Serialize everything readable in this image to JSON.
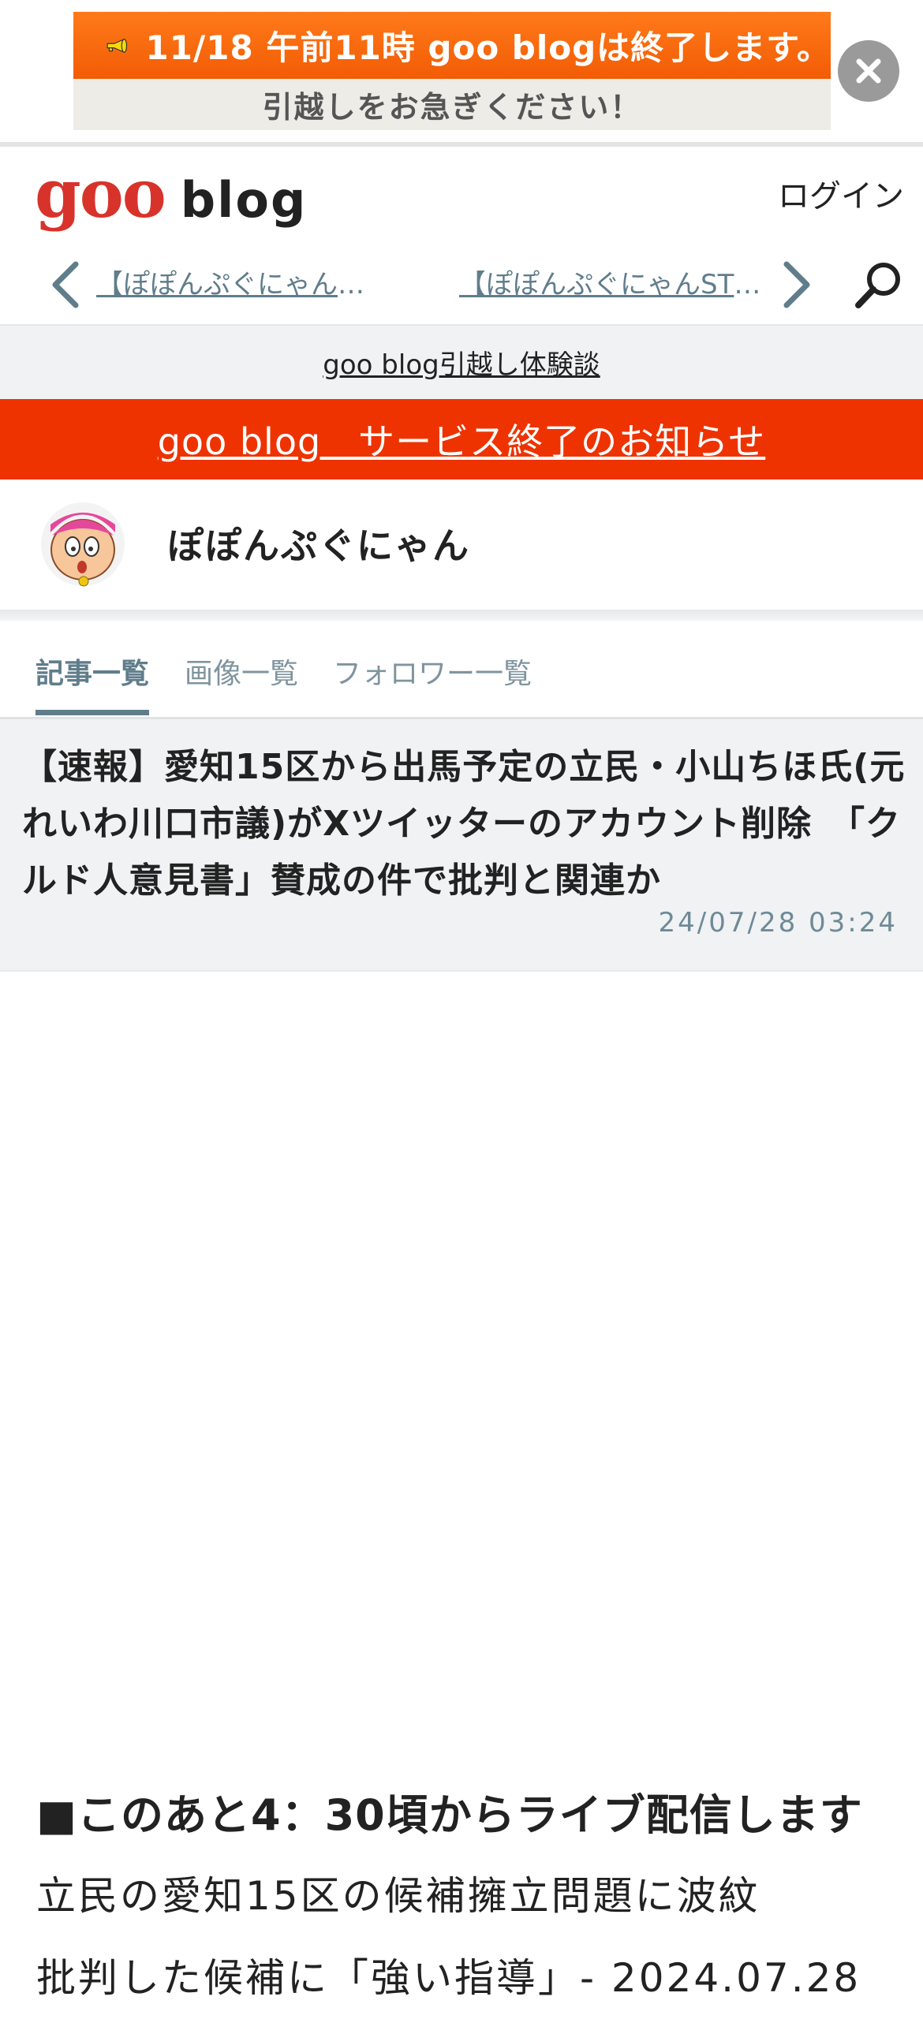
{
  "banner": {
    "line1": "11/18 午前11時 goo blogは終了します。",
    "line2": "引越しをお急ぎください！",
    "close_icon": "close-icon"
  },
  "header": {
    "logo_goo": "goo",
    "logo_blog": "blog",
    "login": "ログイン"
  },
  "nav": {
    "prev": "【ぽぽんぷぐにゃんライブ】",
    "next": "【ぽぽんぷぐにゃんSTUDIO】",
    "search_icon": "search-icon"
  },
  "experience_link": "goo blog引越し体験談",
  "notice_link": "goo blog　サービス終了のお知らせ",
  "profile": {
    "name": "ぽぽんぷぐにゃん"
  },
  "tabs": [
    {
      "label": "記事一覧"
    },
    {
      "label": "画像一覧"
    },
    {
      "label": "フォロワー一覧"
    }
  ],
  "article": {
    "title": "【速報】愛知15区から出馬予定の立民・小山ちほ氏(元れいわ川口市議)がXツイッターのアカウント削除　「クルド人意見書」賛成の件で批判と関連か",
    "date": "24/07/28 03:24",
    "heading": "■このあと4：30頃からライブ配信します",
    "line1": "立民の愛知15区の候補擁立問題に波紋",
    "line2": "批判した候補に「強い指導」- 2024.07.28"
  },
  "colors": {
    "accent": "#ee3300",
    "link_gray": "#607d8b",
    "logo_red": "#d8332b",
    "banner_orange": "#f25c05"
  }
}
